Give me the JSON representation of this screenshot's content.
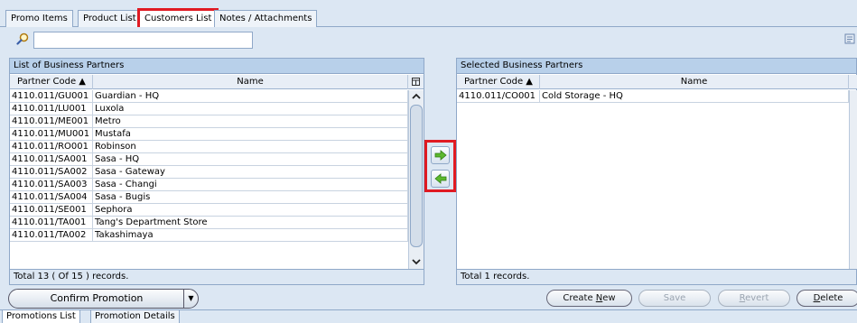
{
  "top_tabs": [
    {
      "label": "Promo Items"
    },
    {
      "label": "Product List"
    },
    {
      "label": "Customers List"
    },
    {
      "label": "Notes / Attachments"
    }
  ],
  "search": {
    "value": "",
    "placeholder": ""
  },
  "left_panel": {
    "title": "List of Business Partners",
    "columns": [
      "Partner Code ▲",
      "Name"
    ],
    "rows": [
      {
        "code": "4110.011/GU001",
        "name": "Guardian - HQ"
      },
      {
        "code": "4110.011/LU001",
        "name": "Luxola"
      },
      {
        "code": "4110.011/ME001",
        "name": "Metro"
      },
      {
        "code": "4110.011/MU001",
        "name": "Mustafa"
      },
      {
        "code": "4110.011/RO001",
        "name": "Robinson"
      },
      {
        "code": "4110.011/SA001",
        "name": "Sasa - HQ"
      },
      {
        "code": "4110.011/SA002",
        "name": "Sasa - Gateway"
      },
      {
        "code": "4110.011/SA003",
        "name": "Sasa - Changi"
      },
      {
        "code": "4110.011/SA004",
        "name": "Sasa - Bugis"
      },
      {
        "code": "4110.011/SE001",
        "name": "Sephora"
      },
      {
        "code": "4110.011/TA001",
        "name": "Tang's Department Store"
      },
      {
        "code": "4110.011/TA002",
        "name": "Takashimaya"
      }
    ],
    "footer": "Total 13 ( Of 15 ) records."
  },
  "right_panel": {
    "title": "Selected Business Partners",
    "columns": [
      "Partner Code ▲",
      "Name"
    ],
    "rows": [
      {
        "code": "4110.011/CO001",
        "name": "Cold Storage - HQ"
      }
    ],
    "footer": "Total 1 records."
  },
  "move_buttons": {
    "add_icon": "arrow-right-icon",
    "remove_icon": "arrow-left-icon"
  },
  "actions": {
    "confirm": "Confirm Promotion",
    "create_new_prefix": "Create ",
    "create_new_key": "N",
    "create_new_suffix": "ew",
    "save": "Save",
    "revert_prefix": "",
    "revert_key": "R",
    "revert_suffix": "evert",
    "delete_prefix": "",
    "delete_key": "D",
    "delete_suffix": "elete"
  },
  "bottom_tabs": [
    {
      "label": "Promotions List"
    },
    {
      "label": "Promotion Details"
    }
  ],
  "colors": {
    "highlight": "#e01a22",
    "panel_title": "#b8d0ea",
    "background": "#dce7f3"
  }
}
